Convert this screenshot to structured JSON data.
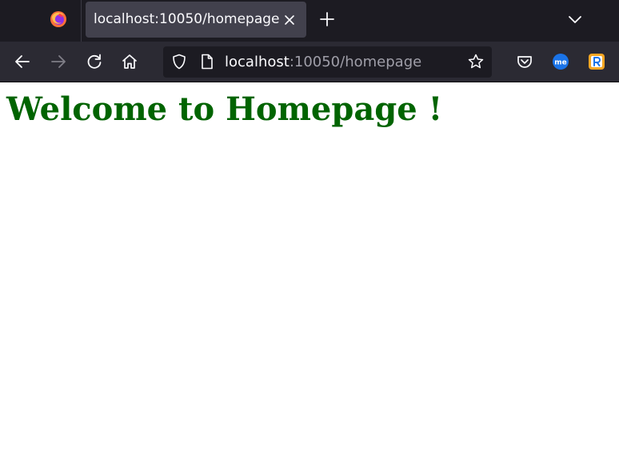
{
  "browser": {
    "tab": {
      "title": "localhost:10050/homepage"
    },
    "urlbar": {
      "host": "localhost",
      "rest": ":10050/homepage"
    },
    "extensions": [
      "pocket-icon",
      "me-extension-icon",
      "r-extension-icon"
    ]
  },
  "page": {
    "heading": "Welcome to Homepage !"
  },
  "colors": {
    "heading": "#006400",
    "tabbar_bg": "#1c1b22",
    "toolbar_bg": "#2b2a33",
    "active_tab_bg": "#42414d"
  }
}
